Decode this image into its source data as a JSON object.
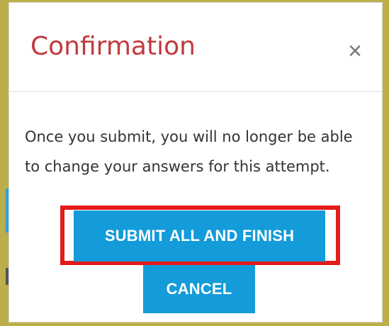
{
  "dialog": {
    "title": "Confirmation",
    "close_symbol": "×",
    "message": "Once you submit, you will no longer be able to change your answers for this attempt.",
    "submit_label": "SUBMIT ALL AND FINISH",
    "cancel_label": "CANCEL"
  },
  "icons": {
    "close": "close-icon"
  },
  "colors": {
    "backdrop": "#bcae4a",
    "title": "#c1393c",
    "button": "#149bd9",
    "highlight": "#e21b1b"
  }
}
